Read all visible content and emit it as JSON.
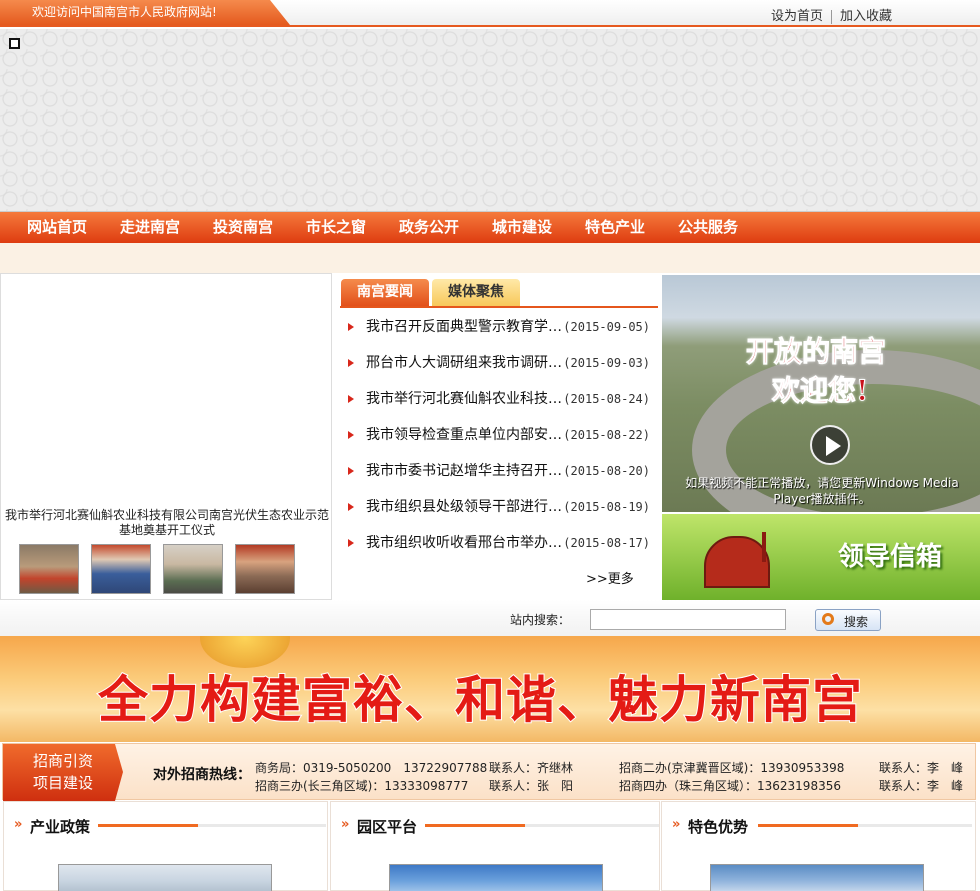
{
  "topbar": {
    "welcome": "欢迎访问中国南宫市人民政府网站!",
    "set_home": "设为首页",
    "add_favorite": "加入收藏"
  },
  "nav": {
    "items": [
      "网站首页",
      "走进南宫",
      "投资南宫",
      "市长之窗",
      "政务公开",
      "城市建设",
      "特色产业",
      "公共服务"
    ]
  },
  "photo_news": {
    "caption": "我市举行河北赛仙斛农业科技有限公司南宫光伏生态农业示范基地奠基开工仪式"
  },
  "news": {
    "tabs": [
      "南宫要闻",
      "媒体聚焦"
    ],
    "items": [
      {
        "title": "我市召开反面典型警示教育学…",
        "date": "(2015-09-05)"
      },
      {
        "title": "邢台市人大调研组来我市调研…",
        "date": "(2015-09-03)"
      },
      {
        "title": "我市举行河北赛仙斛农业科技…",
        "date": "(2015-08-24)"
      },
      {
        "title": "我市领导检查重点单位内部安…",
        "date": "(2015-08-22)"
      },
      {
        "title": "我市市委书记赵增华主持召开…",
        "date": "(2015-08-20)"
      },
      {
        "title": "我市组织县处级领导干部进行…",
        "date": "(2015-08-19)"
      },
      {
        "title": "我市组织收听收看邢台市举办…",
        "date": "(2015-08-17)"
      }
    ],
    "more": ">>更多"
  },
  "video": {
    "title_line1": "开放的南宫",
    "title_line2": "欢迎您!",
    "note": "如果视频不能正常播放，请您更新Windows Media Player播放插件。"
  },
  "leader_mailbox": "领导信箱",
  "search": {
    "label": "站内搜索：",
    "button": "搜索",
    "value": ""
  },
  "slogan": "全力构建富裕、和谐、魅力新南宫",
  "invest": {
    "tag_line1": "招商引资",
    "tag_line2": "项目建设",
    "hotline_label": "对外招商热线：",
    "c1": "商务局：0319-5050200　13722907788",
    "c2": "联系人：齐继林",
    "c3": "招商二办(京津冀晋区域)：13930953398",
    "c4": "联系人：李　峰",
    "c5": "招商三办(长三角区域)：13333098777",
    "c6": "联系人：张　阳",
    "c7": "招商四办（珠三角区域）：13623198356",
    "c8": "联系人：李　峰"
  },
  "sections": [
    "产业政策",
    "园区平台",
    "特色优势"
  ],
  "colors": {
    "accent": "#e65a20",
    "nav": "#de3c10",
    "news_arrow": "#d8271b"
  }
}
